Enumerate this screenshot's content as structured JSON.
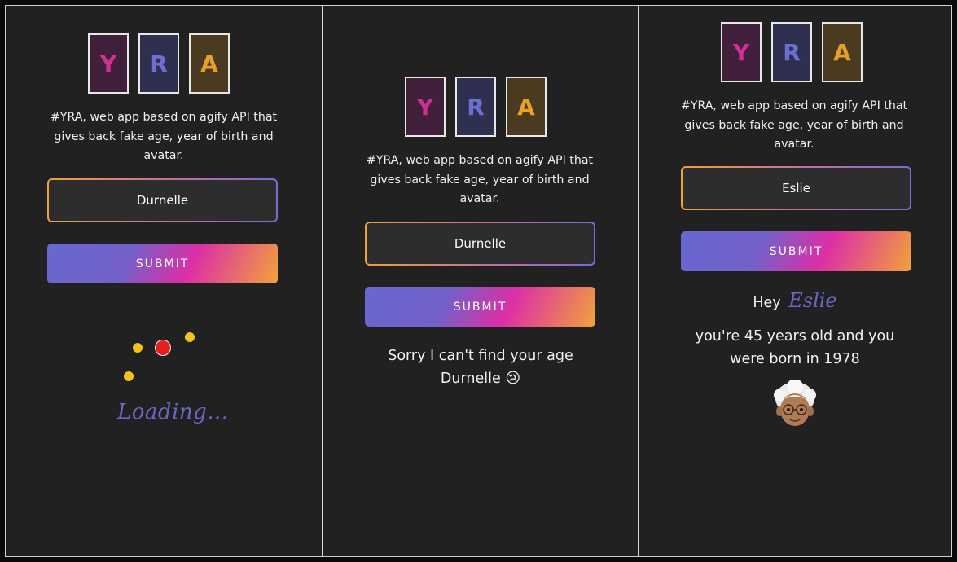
{
  "logo": {
    "letters": [
      "Y",
      "R",
      "A"
    ]
  },
  "description": "#YRA, web app based on agify API that gives back fake age, year of birth and avatar.",
  "submit_label": "SUBMIT",
  "panels": {
    "loading": {
      "input_value": "Durnelle",
      "loading_text": "Loading..."
    },
    "not_found": {
      "input_value": "Durnelle",
      "message_line1": "Sorry I can't find your age",
      "message_name": "Durnelle",
      "message_emoji": "😢"
    },
    "result": {
      "input_value": "Eslie",
      "greeting": "Hey",
      "name": "Eslie",
      "age_line1": "you're 45 years old and you",
      "age_line2": "were born in 1978",
      "avatar_icon": "older-person-emoji"
    }
  },
  "colors": {
    "background": "#212121",
    "y_tile": "#d02f93",
    "r_tile": "#6c6fcf",
    "a_tile": "#e7a12b",
    "accent_text": "#6a66c4",
    "loader_dot": "#f2c31c",
    "loader_dot_active": "#e61e1e"
  }
}
